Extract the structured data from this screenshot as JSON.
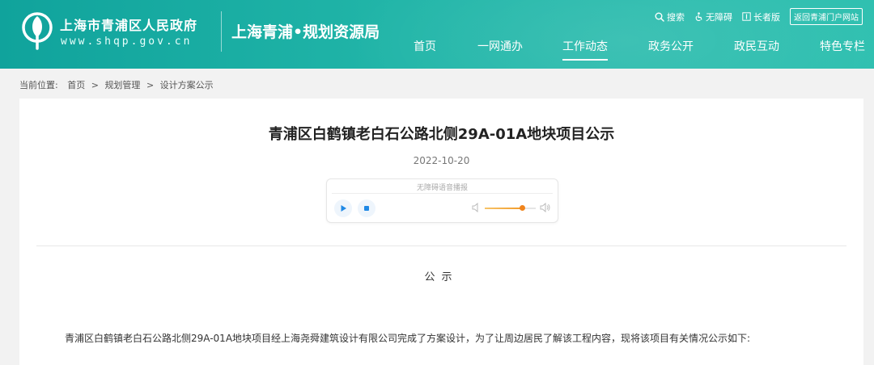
{
  "header": {
    "gov_name": "上海市青浦区人民政府",
    "gov_url": "www.shqp.gov.cn",
    "bureau_title": "上海青浦•规划资源局",
    "colors": {
      "primary": "#14a79f",
      "accent": "#2fc0b0"
    }
  },
  "utility": {
    "search": {
      "label": "搜索",
      "icon": "search-icon"
    },
    "accessibility": {
      "label": "无障碍",
      "icon": "accessibility-icon"
    },
    "elder": {
      "label": "长者版",
      "icon": "elder-mode-icon"
    },
    "portal": "返回青浦门户网站"
  },
  "nav": {
    "items": [
      {
        "label": "首页"
      },
      {
        "label": "一网通办"
      },
      {
        "label": "工作动态",
        "active": true
      },
      {
        "label": "政务公开"
      },
      {
        "label": "政民互动"
      },
      {
        "label": "特色专栏"
      }
    ]
  },
  "breadcrumb": {
    "prefix": "当前位置:",
    "items": [
      "首页",
      "规划管理",
      "设计方案公示"
    ],
    "separator": ">"
  },
  "article": {
    "title": "青浦区白鹤镇老白石公路北侧29A-01A地块项目公示",
    "date": "2022-10-20",
    "notice_heading": "公示",
    "body_first_line": "青浦区白鹤镇老白石公路北侧29A-01A地块项目经上海尧舜建筑设计有限公司完成了方案设计，为了让周边居民了解该工程内容，现将该项目有关情况公示如下:"
  },
  "player": {
    "label": "无障碍语音播报",
    "volume_level": 0.75,
    "icons": [
      "play-icon",
      "stop-icon",
      "volume-low-icon",
      "volume-high-icon"
    ]
  }
}
